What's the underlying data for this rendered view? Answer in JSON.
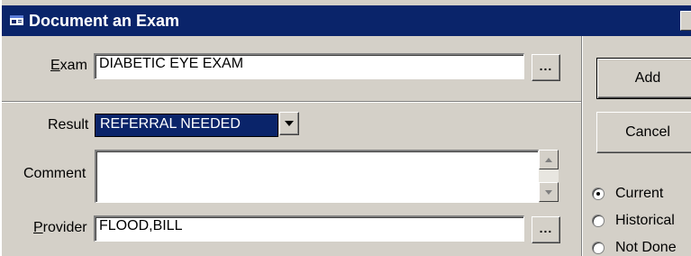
{
  "window": {
    "title": "Document an Exam"
  },
  "exam": {
    "label_accel": "E",
    "label_rest": "xam",
    "value": "DIABETIC EYE EXAM",
    "browse_label": "..."
  },
  "result": {
    "label": "Result",
    "selected": "REFERRAL NEEDED"
  },
  "comment": {
    "label": "Comment",
    "value": ""
  },
  "provider": {
    "label_accel": "P",
    "label_rest": "rovider",
    "value": "FLOOD,BILL",
    "browse_label": "..."
  },
  "buttons": {
    "add": "Add",
    "cancel": "Cancel"
  },
  "status": {
    "options": [
      "Current",
      "Historical",
      "Not Done"
    ],
    "selected": "Current"
  },
  "colors": {
    "titlebar": "#0a246a",
    "face": "#d4d0c8",
    "selection": "#0a246a"
  }
}
